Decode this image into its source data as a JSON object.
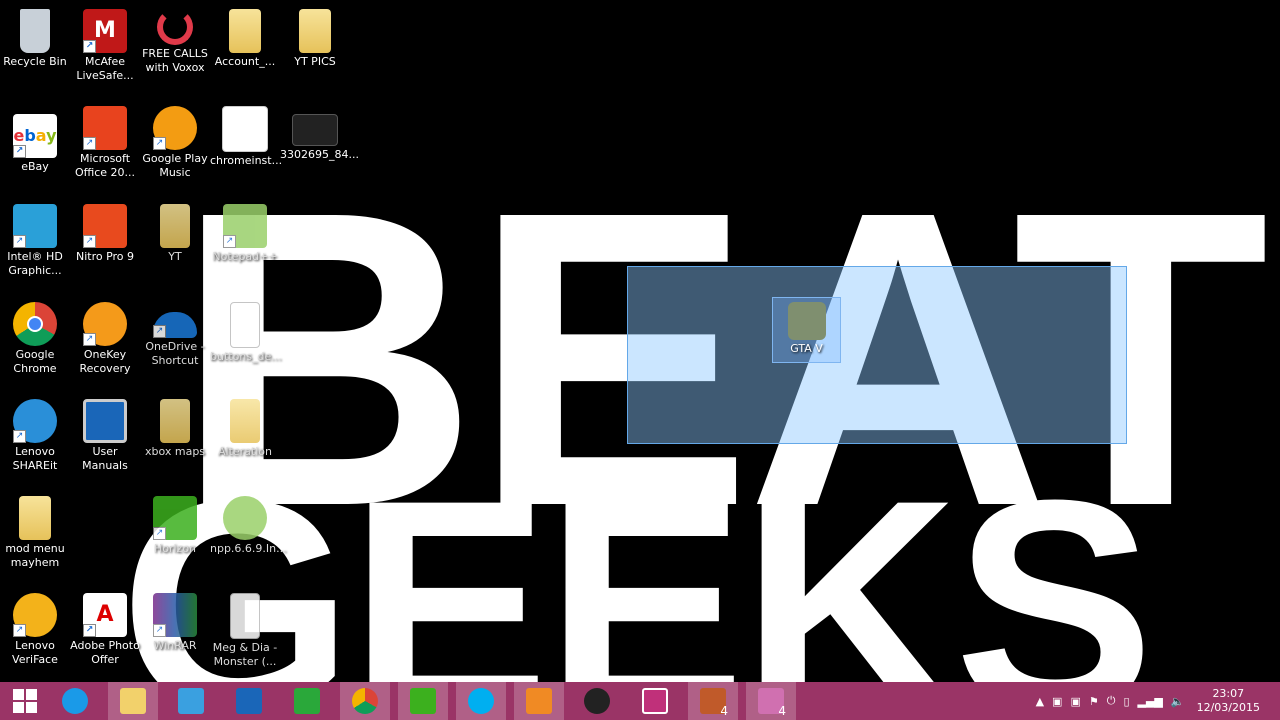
{
  "wallpaper": {
    "line1": "BEAT",
    "line2": "GEEKS"
  },
  "desktop_icons": [
    {
      "label": "Recycle Bin",
      "icon": "recycle-bin-icon"
    },
    {
      "label": "McAfee LiveSafe...",
      "icon": "mcafee-icon"
    },
    {
      "label": "FREE CALLS with Voxox",
      "icon": "voxox-icon"
    },
    {
      "label": "Account_...",
      "icon": "folder-icon"
    },
    {
      "label": "YT PICS",
      "icon": "folder-icon"
    },
    {
      "label": "eBay",
      "icon": "ebay-icon"
    },
    {
      "label": "Microsoft Office 20...",
      "icon": "office-icon"
    },
    {
      "label": "Google Play Music",
      "icon": "headphones-icon"
    },
    {
      "label": "chromeinst...",
      "icon": "java-installer-icon"
    },
    {
      "label": "3302695_84...",
      "icon": "video-file-icon"
    },
    {
      "label": "Intel® HD Graphic...",
      "icon": "intel-graphics-icon"
    },
    {
      "label": "Nitro Pro 9",
      "icon": "nitro-pdf-icon"
    },
    {
      "label": "YT",
      "icon": "folder-icon"
    },
    {
      "label": "Notepad++",
      "icon": "notepadpp-icon"
    },
    {
      "label": "Google Chrome",
      "icon": "chrome-icon"
    },
    {
      "label": "OneKey Recovery",
      "icon": "onekey-recovery-icon"
    },
    {
      "label": "OneDrive - Shortcut",
      "icon": "onedrive-icon"
    },
    {
      "label": "buttons_de...",
      "icon": "blank-file-icon"
    },
    {
      "label": "Lenovo SHAREit",
      "icon": "shareit-icon"
    },
    {
      "label": "User Manuals",
      "icon": "lenovo-manuals-icon"
    },
    {
      "label": "xbox maps",
      "icon": "folder-icon"
    },
    {
      "label": "Alteration",
      "icon": "folder-icon"
    },
    {
      "label": "mod menu mayhem",
      "icon": "folder-icon"
    },
    {
      "label": "Horizon",
      "icon": "horizon-icon"
    },
    {
      "label": "npp.6.6.9.In...",
      "icon": "notepadpp-installer-icon"
    },
    {
      "label": "Lenovo VeriFace",
      "icon": "veriface-icon"
    },
    {
      "label": "Adobe Photo Offer",
      "icon": "adobe-icon"
    },
    {
      "label": "WinRAR",
      "icon": "winrar-icon"
    },
    {
      "label": "Meg & Dia - Monster (...",
      "icon": "mp3-file-icon"
    },
    {
      "label": "GTA V",
      "icon": "gta-v-icon"
    }
  ],
  "taskbar": {
    "start_icon": "windows-start-icon",
    "pinned": [
      {
        "name": "internet-explorer-icon"
      },
      {
        "name": "file-explorer-icon"
      },
      {
        "name": "store-bag-icon"
      },
      {
        "name": "lenovo-monitor-icon"
      },
      {
        "name": "windows-store-icon"
      },
      {
        "name": "chrome-icon"
      },
      {
        "name": "horizon-icon"
      },
      {
        "name": "skype-icon"
      },
      {
        "name": "media-player-icon"
      },
      {
        "name": "dark-app-icon"
      },
      {
        "name": "camera-app-icon"
      },
      {
        "name": "badge-app-icon"
      },
      {
        "name": "photo-app-icon"
      }
    ],
    "badge_count": "4",
    "badge_count_2": "4",
    "clock_time": "23:07",
    "clock_date": "12/03/2015"
  },
  "colors": {
    "taskbar": "#9a3466",
    "selection": "#8cc8ff",
    "accent": "#1c6cd2"
  }
}
